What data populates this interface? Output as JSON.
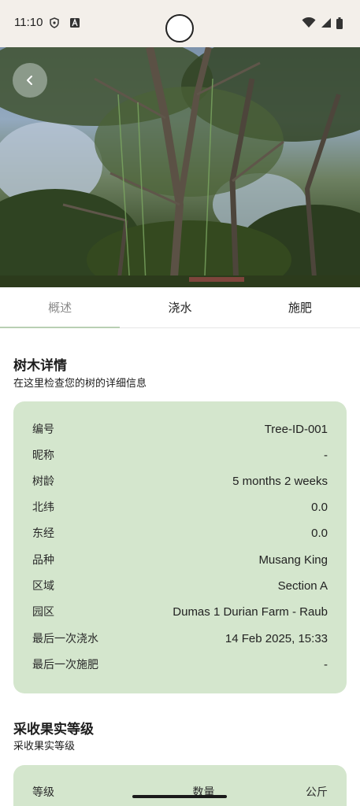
{
  "status": {
    "time": "11:10"
  },
  "tabs": [
    {
      "label": "概述"
    },
    {
      "label": "浇水"
    },
    {
      "label": "施肥"
    }
  ],
  "details_section": {
    "title": "树木详情",
    "subtitle": "在这里检查您的树的详细信息"
  },
  "details": [
    {
      "label": "编号",
      "value": "Tree-ID-001"
    },
    {
      "label": "昵称",
      "value": "-"
    },
    {
      "label": "树龄",
      "value": "5 months 2 weeks"
    },
    {
      "label": "北纬",
      "value": "0.0"
    },
    {
      "label": "东经",
      "value": "0.0"
    },
    {
      "label": "品种",
      "value": "Musang King"
    },
    {
      "label": "区域",
      "value": "Section A"
    },
    {
      "label": "园区",
      "value": "Dumas 1 Durian Farm - Raub"
    },
    {
      "label": "最后一次浇水",
      "value": "14 Feb 2025, 15:33"
    },
    {
      "label": "最后一次施肥",
      "value": "-"
    }
  ],
  "harvest_section": {
    "title": "采收果实等级",
    "subtitle": "采收果实等级"
  },
  "harvest_table": {
    "headers": [
      "等级",
      "数量",
      "公斤"
    ]
  },
  "colors": {
    "card": "#d4e6cd",
    "tab_indicator": "#b9cfb3",
    "status_bar": "#f3efea"
  }
}
